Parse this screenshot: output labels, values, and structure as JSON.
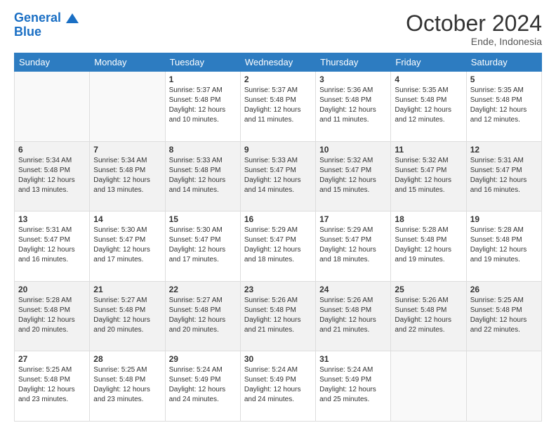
{
  "header": {
    "logo_line1": "General",
    "logo_line2": "Blue",
    "month": "October 2024",
    "location": "Ende, Indonesia"
  },
  "weekdays": [
    "Sunday",
    "Monday",
    "Tuesday",
    "Wednesday",
    "Thursday",
    "Friday",
    "Saturday"
  ],
  "weeks": [
    [
      {
        "day": "",
        "info": ""
      },
      {
        "day": "",
        "info": ""
      },
      {
        "day": "1",
        "info": "Sunrise: 5:37 AM\nSunset: 5:48 PM\nDaylight: 12 hours\nand 10 minutes."
      },
      {
        "day": "2",
        "info": "Sunrise: 5:37 AM\nSunset: 5:48 PM\nDaylight: 12 hours\nand 11 minutes."
      },
      {
        "day": "3",
        "info": "Sunrise: 5:36 AM\nSunset: 5:48 PM\nDaylight: 12 hours\nand 11 minutes."
      },
      {
        "day": "4",
        "info": "Sunrise: 5:35 AM\nSunset: 5:48 PM\nDaylight: 12 hours\nand 12 minutes."
      },
      {
        "day": "5",
        "info": "Sunrise: 5:35 AM\nSunset: 5:48 PM\nDaylight: 12 hours\nand 12 minutes."
      }
    ],
    [
      {
        "day": "6",
        "info": "Sunrise: 5:34 AM\nSunset: 5:48 PM\nDaylight: 12 hours\nand 13 minutes."
      },
      {
        "day": "7",
        "info": "Sunrise: 5:34 AM\nSunset: 5:48 PM\nDaylight: 12 hours\nand 13 minutes."
      },
      {
        "day": "8",
        "info": "Sunrise: 5:33 AM\nSunset: 5:48 PM\nDaylight: 12 hours\nand 14 minutes."
      },
      {
        "day": "9",
        "info": "Sunrise: 5:33 AM\nSunset: 5:47 PM\nDaylight: 12 hours\nand 14 minutes."
      },
      {
        "day": "10",
        "info": "Sunrise: 5:32 AM\nSunset: 5:47 PM\nDaylight: 12 hours\nand 15 minutes."
      },
      {
        "day": "11",
        "info": "Sunrise: 5:32 AM\nSunset: 5:47 PM\nDaylight: 12 hours\nand 15 minutes."
      },
      {
        "day": "12",
        "info": "Sunrise: 5:31 AM\nSunset: 5:47 PM\nDaylight: 12 hours\nand 16 minutes."
      }
    ],
    [
      {
        "day": "13",
        "info": "Sunrise: 5:31 AM\nSunset: 5:47 PM\nDaylight: 12 hours\nand 16 minutes."
      },
      {
        "day": "14",
        "info": "Sunrise: 5:30 AM\nSunset: 5:47 PM\nDaylight: 12 hours\nand 17 minutes."
      },
      {
        "day": "15",
        "info": "Sunrise: 5:30 AM\nSunset: 5:47 PM\nDaylight: 12 hours\nand 17 minutes."
      },
      {
        "day": "16",
        "info": "Sunrise: 5:29 AM\nSunset: 5:47 PM\nDaylight: 12 hours\nand 18 minutes."
      },
      {
        "day": "17",
        "info": "Sunrise: 5:29 AM\nSunset: 5:47 PM\nDaylight: 12 hours\nand 18 minutes."
      },
      {
        "day": "18",
        "info": "Sunrise: 5:28 AM\nSunset: 5:48 PM\nDaylight: 12 hours\nand 19 minutes."
      },
      {
        "day": "19",
        "info": "Sunrise: 5:28 AM\nSunset: 5:48 PM\nDaylight: 12 hours\nand 19 minutes."
      }
    ],
    [
      {
        "day": "20",
        "info": "Sunrise: 5:28 AM\nSunset: 5:48 PM\nDaylight: 12 hours\nand 20 minutes."
      },
      {
        "day": "21",
        "info": "Sunrise: 5:27 AM\nSunset: 5:48 PM\nDaylight: 12 hours\nand 20 minutes."
      },
      {
        "day": "22",
        "info": "Sunrise: 5:27 AM\nSunset: 5:48 PM\nDaylight: 12 hours\nand 20 minutes."
      },
      {
        "day": "23",
        "info": "Sunrise: 5:26 AM\nSunset: 5:48 PM\nDaylight: 12 hours\nand 21 minutes."
      },
      {
        "day": "24",
        "info": "Sunrise: 5:26 AM\nSunset: 5:48 PM\nDaylight: 12 hours\nand 21 minutes."
      },
      {
        "day": "25",
        "info": "Sunrise: 5:26 AM\nSunset: 5:48 PM\nDaylight: 12 hours\nand 22 minutes."
      },
      {
        "day": "26",
        "info": "Sunrise: 5:25 AM\nSunset: 5:48 PM\nDaylight: 12 hours\nand 22 minutes."
      }
    ],
    [
      {
        "day": "27",
        "info": "Sunrise: 5:25 AM\nSunset: 5:48 PM\nDaylight: 12 hours\nand 23 minutes."
      },
      {
        "day": "28",
        "info": "Sunrise: 5:25 AM\nSunset: 5:48 PM\nDaylight: 12 hours\nand 23 minutes."
      },
      {
        "day": "29",
        "info": "Sunrise: 5:24 AM\nSunset: 5:49 PM\nDaylight: 12 hours\nand 24 minutes."
      },
      {
        "day": "30",
        "info": "Sunrise: 5:24 AM\nSunset: 5:49 PM\nDaylight: 12 hours\nand 24 minutes."
      },
      {
        "day": "31",
        "info": "Sunrise: 5:24 AM\nSunset: 5:49 PM\nDaylight: 12 hours\nand 25 minutes."
      },
      {
        "day": "",
        "info": ""
      },
      {
        "day": "",
        "info": ""
      }
    ]
  ]
}
